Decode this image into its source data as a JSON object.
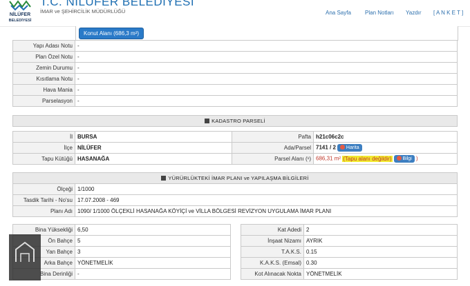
{
  "header": {
    "title": "T.C. NİLÜFER BELEDİYESİ",
    "subtitle": "İMAR ve ŞEHİRCİLİK MÜDÜRLÜĞÜ",
    "logo_text": "NİLÜFER BELEDİYESİ",
    "nav": [
      "Ana Sayfa",
      "Plan Notları",
      "Yazdır",
      "[ A N K E T ]"
    ]
  },
  "top": {
    "konut_button": "Konut Alanı (686,3 m²)",
    "rows": [
      {
        "label": "Yapı Adası Notu",
        "value": "-"
      },
      {
        "label": "Plan Özel Notu",
        "value": "-"
      },
      {
        "label": "Zemin Durumu",
        "value": "-"
      },
      {
        "label": "Kısıtlama Notu",
        "value": "-"
      },
      {
        "label": "Hava Mania",
        "value": "-"
      },
      {
        "label": "Parselasyon",
        "value": "-"
      }
    ]
  },
  "kadastro": {
    "heading": "KADASTRO PARSELİ",
    "il_label": "İl",
    "il_value": "BURSA",
    "ilce_label": "İlçe",
    "ilce_value": "NİLÜFER",
    "tapu_label": "Tapu Kütüğü",
    "tapu_value": "HASANAĞA",
    "pafta_label": "Pafta",
    "pafta_value": "h21c06c2c",
    "ada_label": "Ada/Parsel",
    "ada_value": "7141 / 2",
    "harita_button": "Harita",
    "alan_label": "Parsel Alanı (¹)",
    "alan_value": "686,31 m²",
    "alan_warning": "(Tapu alanı değildir)",
    "bilgi_button": "Bilgi",
    "alan_close": ")"
  },
  "imar": {
    "heading": "YÜRÜRLÜKTEKİ İMAR PLANI ve YAPILAŞMA BİLGİLERİ",
    "olcek_label": "Ölçeği",
    "olcek_value": "1/1000",
    "tasdik_label": "Tasdik Tarihi - No'su",
    "tasdik_value": "17.07.2008 - 469",
    "plan_label": "Planı Adı",
    "plan_value": "1090/ 1/1000 ÖLÇEKLİ HASANAĞA KÖYİÇİ ve VİLLA BÖLGESİ REVİZYON UYGULAMA İMAR PLANI"
  },
  "yapi_left": [
    {
      "label": "Bina Yüksekliği",
      "value": "6,50"
    },
    {
      "label": "Ön Bahçe",
      "value": "5"
    },
    {
      "label": "Yan Bahçe",
      "value": "3"
    },
    {
      "label": "Arka Bahçe",
      "value": "YÖNETMELİK"
    },
    {
      "label": "Bina Derinliği",
      "value": "-"
    }
  ],
  "yapi_right": [
    {
      "label": "Kat Adedi",
      "value": "2"
    },
    {
      "label": "İnşaat Nizamı",
      "value": "AYRIK"
    },
    {
      "label": "T.A.K.S.",
      "value": "0.15"
    },
    {
      "label": "K.A.K.S. (Emsal)",
      "value": "0.30"
    },
    {
      "label": "Kot Alınacak Nokta",
      "value": "YÖNETMELİK"
    }
  ]
}
